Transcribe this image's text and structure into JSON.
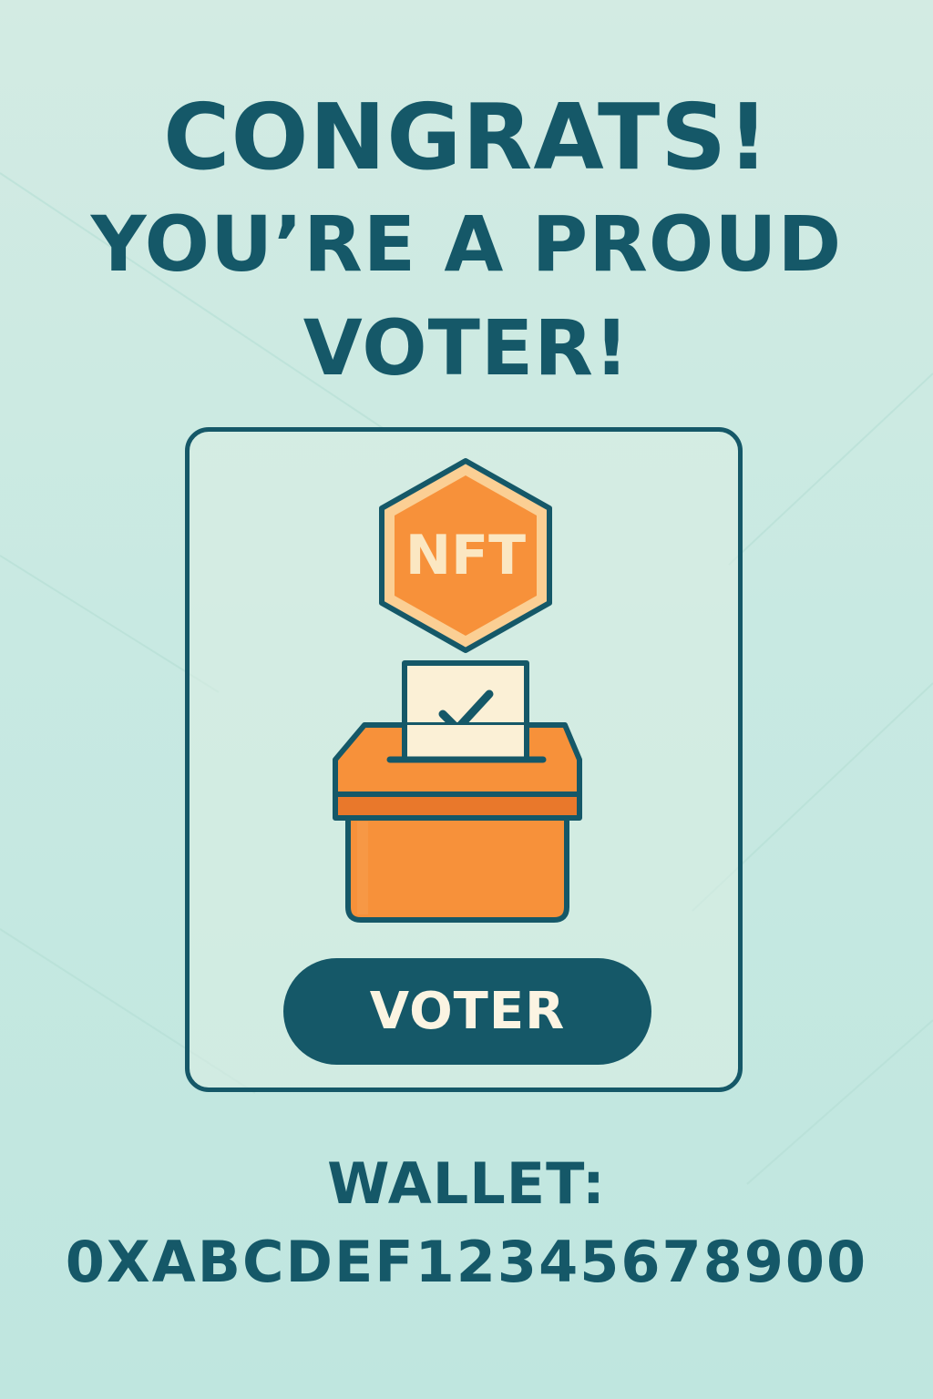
{
  "headline": {
    "line1": "CONGRATS!",
    "line2": "YOU’RE A PROUD",
    "line3": "VOTER!"
  },
  "card": {
    "badge_text": "NFT",
    "badge_icon": "hexagon-badge",
    "ballot_icon": "ballot-box-with-checkmark",
    "pill_label": "VOTER"
  },
  "wallet": {
    "label": "WALLET:",
    "address": "0XABCDEF12345678900"
  },
  "colors": {
    "primary": "#155868",
    "accent_orange": "#f7913a",
    "light_cream": "#fbf0d6",
    "background": "#c9e9e2"
  }
}
